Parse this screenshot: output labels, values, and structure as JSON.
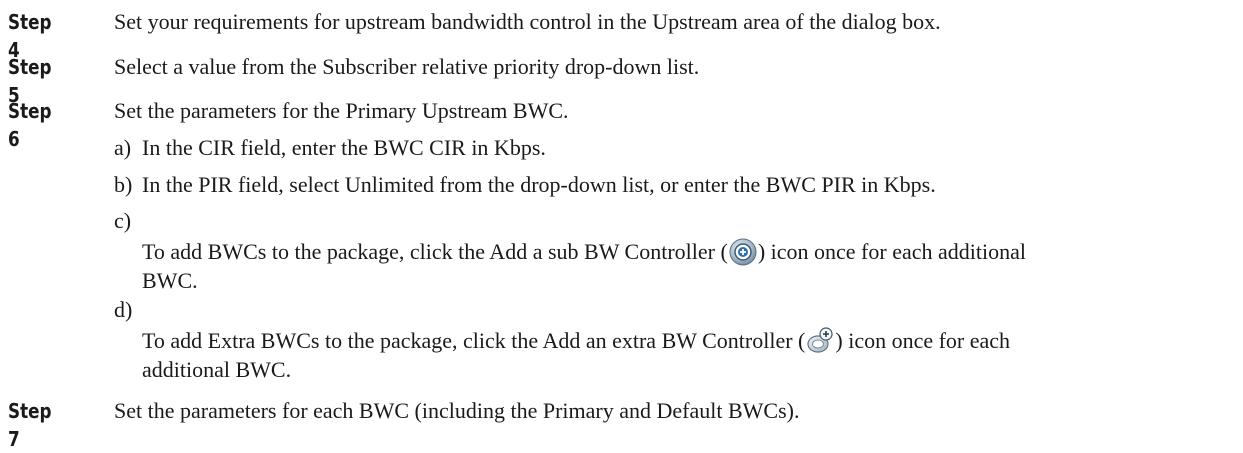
{
  "steps": [
    {
      "label": "Step 4",
      "text": "Set your requirements for upstream bandwidth control in the Upstream area of the dialog box."
    },
    {
      "label": "Step 5",
      "text": "Select a value from the Subscriber relative priority drop-down list."
    },
    {
      "label": "Step 6",
      "text": "Set the parameters for the Primary Upstream BWC."
    },
    {
      "label": "Step 7",
      "text": "Set the parameters for each BWC (including the Primary and Default BWCs)."
    }
  ],
  "substeps": [
    {
      "marker": "a)",
      "text": "In the CIR field, enter the BWC CIR in Kbps."
    },
    {
      "marker": "b)",
      "text": "In the PIR field, select Unlimited from the drop-down list, or enter the BWC PIR in Kbps."
    },
    {
      "marker": "c)",
      "before": "To add BWCs to the package, click the Add a sub BW Controller (",
      "after": ") icon once for each additional",
      "cont": "BWC."
    },
    {
      "marker": "d)",
      "before": "To add Extra BWCs to the package, click the Add an extra BW Controller (",
      "after": ") icon once for each",
      "cont": "additional BWC."
    }
  ],
  "icons": {
    "sub": "add-sub-bw-controller-icon",
    "extra": "add-extra-bw-controller-icon"
  }
}
